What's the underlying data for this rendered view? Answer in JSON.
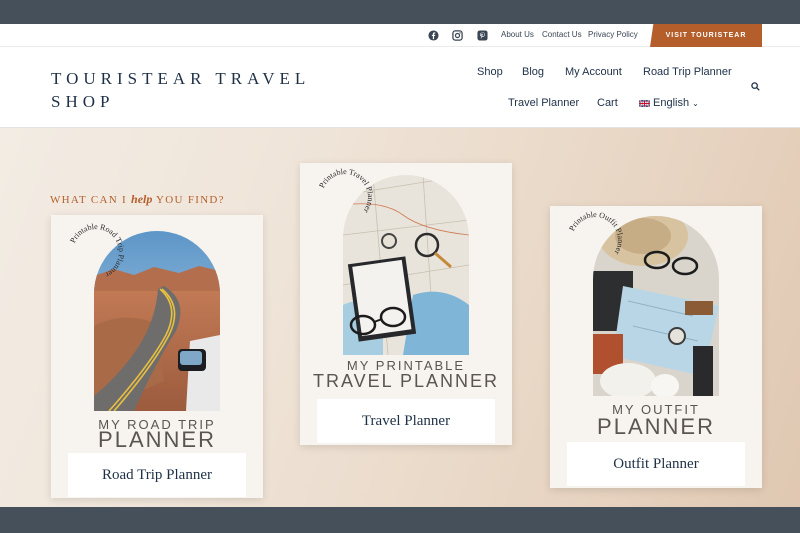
{
  "utility": {
    "social": [
      "facebook-icon",
      "instagram-icon",
      "pinterest-icon"
    ],
    "links": [
      "About Us",
      "Contact Us",
      "Privacy Policy"
    ],
    "visit_label": "VISIT TOURISTEAR"
  },
  "header": {
    "site_title_line1": "TOURISTEAR TRAVEL",
    "site_title_line2": "SHOP",
    "nav_row1": [
      "Shop",
      "Blog",
      "My Account",
      "Road Trip Planner"
    ],
    "nav_row2": [
      "Travel Planner",
      "Cart"
    ],
    "language": "English",
    "language_flag": "uk-flag-icon"
  },
  "hero": {
    "heading_pre": "WHAT CAN I",
    "heading_script": "help",
    "heading_post": "YOU FIND?"
  },
  "cards": [
    {
      "circle_text": "Printable Road Trip Planner",
      "subtitle": "MY ROAD TRIP",
      "title": "PLANNER",
      "button": "Road Trip Planner"
    },
    {
      "circle_text": "Printable Travel Planner",
      "subtitle": "MY PRINTABLE",
      "title": "TRAVEL PLANNER",
      "button": "Travel Planner"
    },
    {
      "circle_text": "Printable Outfit Planner",
      "subtitle": "MY OUTFIT",
      "title": "PLANNER",
      "button": "Outfit Planner"
    }
  ],
  "colors": {
    "accent": "#b45f2b",
    "navy": "#1e3046",
    "band": "#46505b"
  }
}
